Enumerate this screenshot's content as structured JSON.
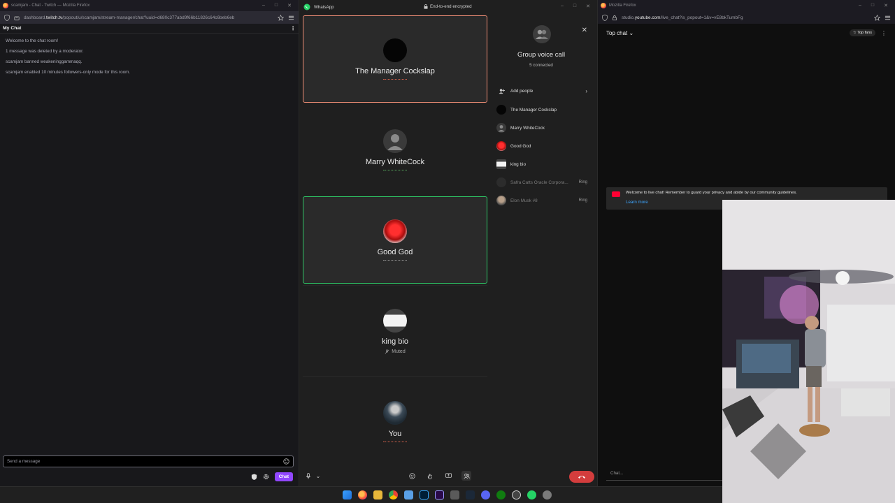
{
  "twitch": {
    "window_title": "scamjam - Chat - Twitch — Mozilla Firefox",
    "url_prefix": "dashboard.",
    "url_host": "twitch.tv",
    "url_path": "/popout/u/scamjam/stream-manager/chat?uuid=d680c377abd9f66b11826c64c6beb6eb",
    "chat_header": "My Chat",
    "messages": [
      "Welcome to the chat room!",
      "1 message was deleted by a moderator.",
      "scamjam banned weakeninggammaqq.",
      "scamjam enabled 10 minutes followers-only mode for this room."
    ],
    "input_placeholder": "Send a message",
    "chat_button": "Chat",
    "accent_color": "#9147ff"
  },
  "whatsapp": {
    "app_title": "WhatsApp",
    "encryption_label": "End-to-end encrypted",
    "tiles": [
      {
        "name": "The Manager Cockslap",
        "state": "speaking"
      },
      {
        "name": "Marry WhiteCock",
        "state": "normal"
      },
      {
        "name": "Good God",
        "state": "active"
      },
      {
        "name": "king bio",
        "state": "muted",
        "status": "Muted"
      },
      {
        "name": "You",
        "state": "self"
      }
    ],
    "panel": {
      "title": "Group voice call",
      "subtitle": "5 connected",
      "add_people": "Add people",
      "participants": [
        {
          "name": "The Manager Cockslap",
          "ring": ""
        },
        {
          "name": "Marry WhiteCock",
          "ring": ""
        },
        {
          "name": "Good God",
          "ring": ""
        },
        {
          "name": "king bio",
          "ring": ""
        },
        {
          "name": "Safra Catts Oracle Corpora...",
          "ring": "Ring"
        },
        {
          "name": "Elon Musk #8",
          "ring": "Ring"
        }
      ]
    },
    "speaking_color": "#f08e76",
    "active_color": "#2ec866",
    "end_call_color": "#d33d3d"
  },
  "youtube": {
    "window_title": "Mozilla Firefox",
    "url_prefix": "studio.",
    "url_host": "youtube.com",
    "url_path": "/live_chat?is_popout=1&v=vE8bkTumbFg",
    "chat_mode": "Top chat",
    "top_fans": "Top fans",
    "notice_text": "Welcome to live chat! Remember to guard your privacy and abide by our community guidelines.",
    "learn_more": "Learn more",
    "input_placeholder": "Chat..."
  },
  "taskbar": {
    "icons": [
      "windows-start-icon",
      "firefox-icon",
      "chrome-icon",
      "file-explorer-icon",
      "notepad-icon",
      "photoshop-icon",
      "premiere-icon",
      "calculator-icon",
      "steam-icon",
      "discord-icon",
      "xbox-icon",
      "powertoys-icon",
      "whatsapp-icon",
      "settings-icon"
    ]
  }
}
